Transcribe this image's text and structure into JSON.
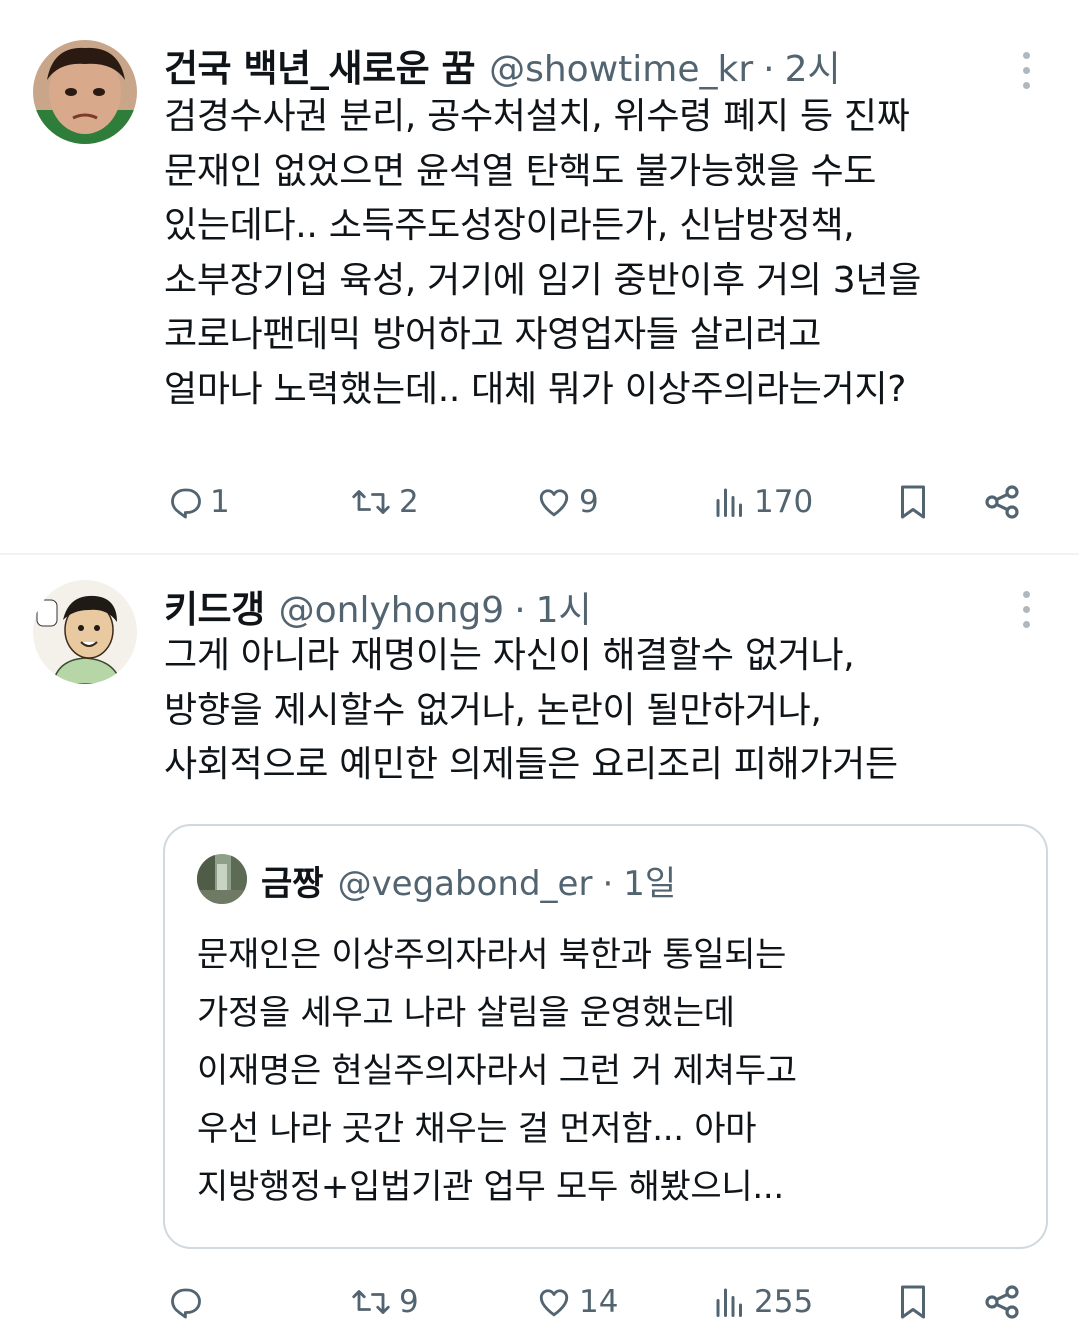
{
  "tweets": [
    {
      "display_name": "건국 백년_새로운 꿈",
      "handle": "@showtime_kr",
      "separator": "·",
      "time": "2시",
      "text": "검경수사권 분리, 공수처설치, 위수령 폐지 등 진짜\n문재인 없었으면 윤석열 탄핵도 불가능했을 수도\n있는데다.. 소득주도성장이라든가, 신남방정책,\n소부장기업 육성, 거기에 임기 중반이후 거의 3년을\n코로나팬데믹 방어하고 자영업자들 살리려고\n얼마나 노력했는데.. 대체 뭐가 이상주의라는거지?",
      "stats": {
        "replies": "1",
        "retweets": "2",
        "likes": "9",
        "views": "170"
      }
    },
    {
      "display_name": "키드갱",
      "handle": "@onlyhong9",
      "separator": "·",
      "time": "1시",
      "text": "그게 아니라 재명이는 자신이 해결할수 없거나,\n방향을 제시할수 없거나, 논란이 될만하거나,\n사회적으로 예민한 의제들은 요리조리 피해가거든",
      "quote": {
        "display_name": "금짱",
        "handle": "@vegabond_er",
        "separator": "·",
        "time": "1일",
        "text": "문재인은 이상주의자라서 북한과 통일되는\n가정을 세우고 나라 살림을 운영했는데\n이재명은 현실주의자라서 그런 거 제쳐두고\n우선 나라 곳간 채우는 걸 먼저함... 아마\n지방행정+입법기관 업무 모두 해봤으니..."
      },
      "stats": {
        "replies": "",
        "retweets": "9",
        "likes": "14",
        "views": "255"
      }
    }
  ],
  "icons": {
    "reply": "reply-icon",
    "retweet": "retweet-icon",
    "like": "heart-icon",
    "views": "views-chart-icon",
    "bookmark": "bookmark-icon",
    "share": "share-icon",
    "more": "more-vertical-icon"
  },
  "colors": {
    "text": "#0f1419",
    "secondary": "#536471",
    "border": "#cfd9de",
    "divider": "#eff3f4"
  }
}
